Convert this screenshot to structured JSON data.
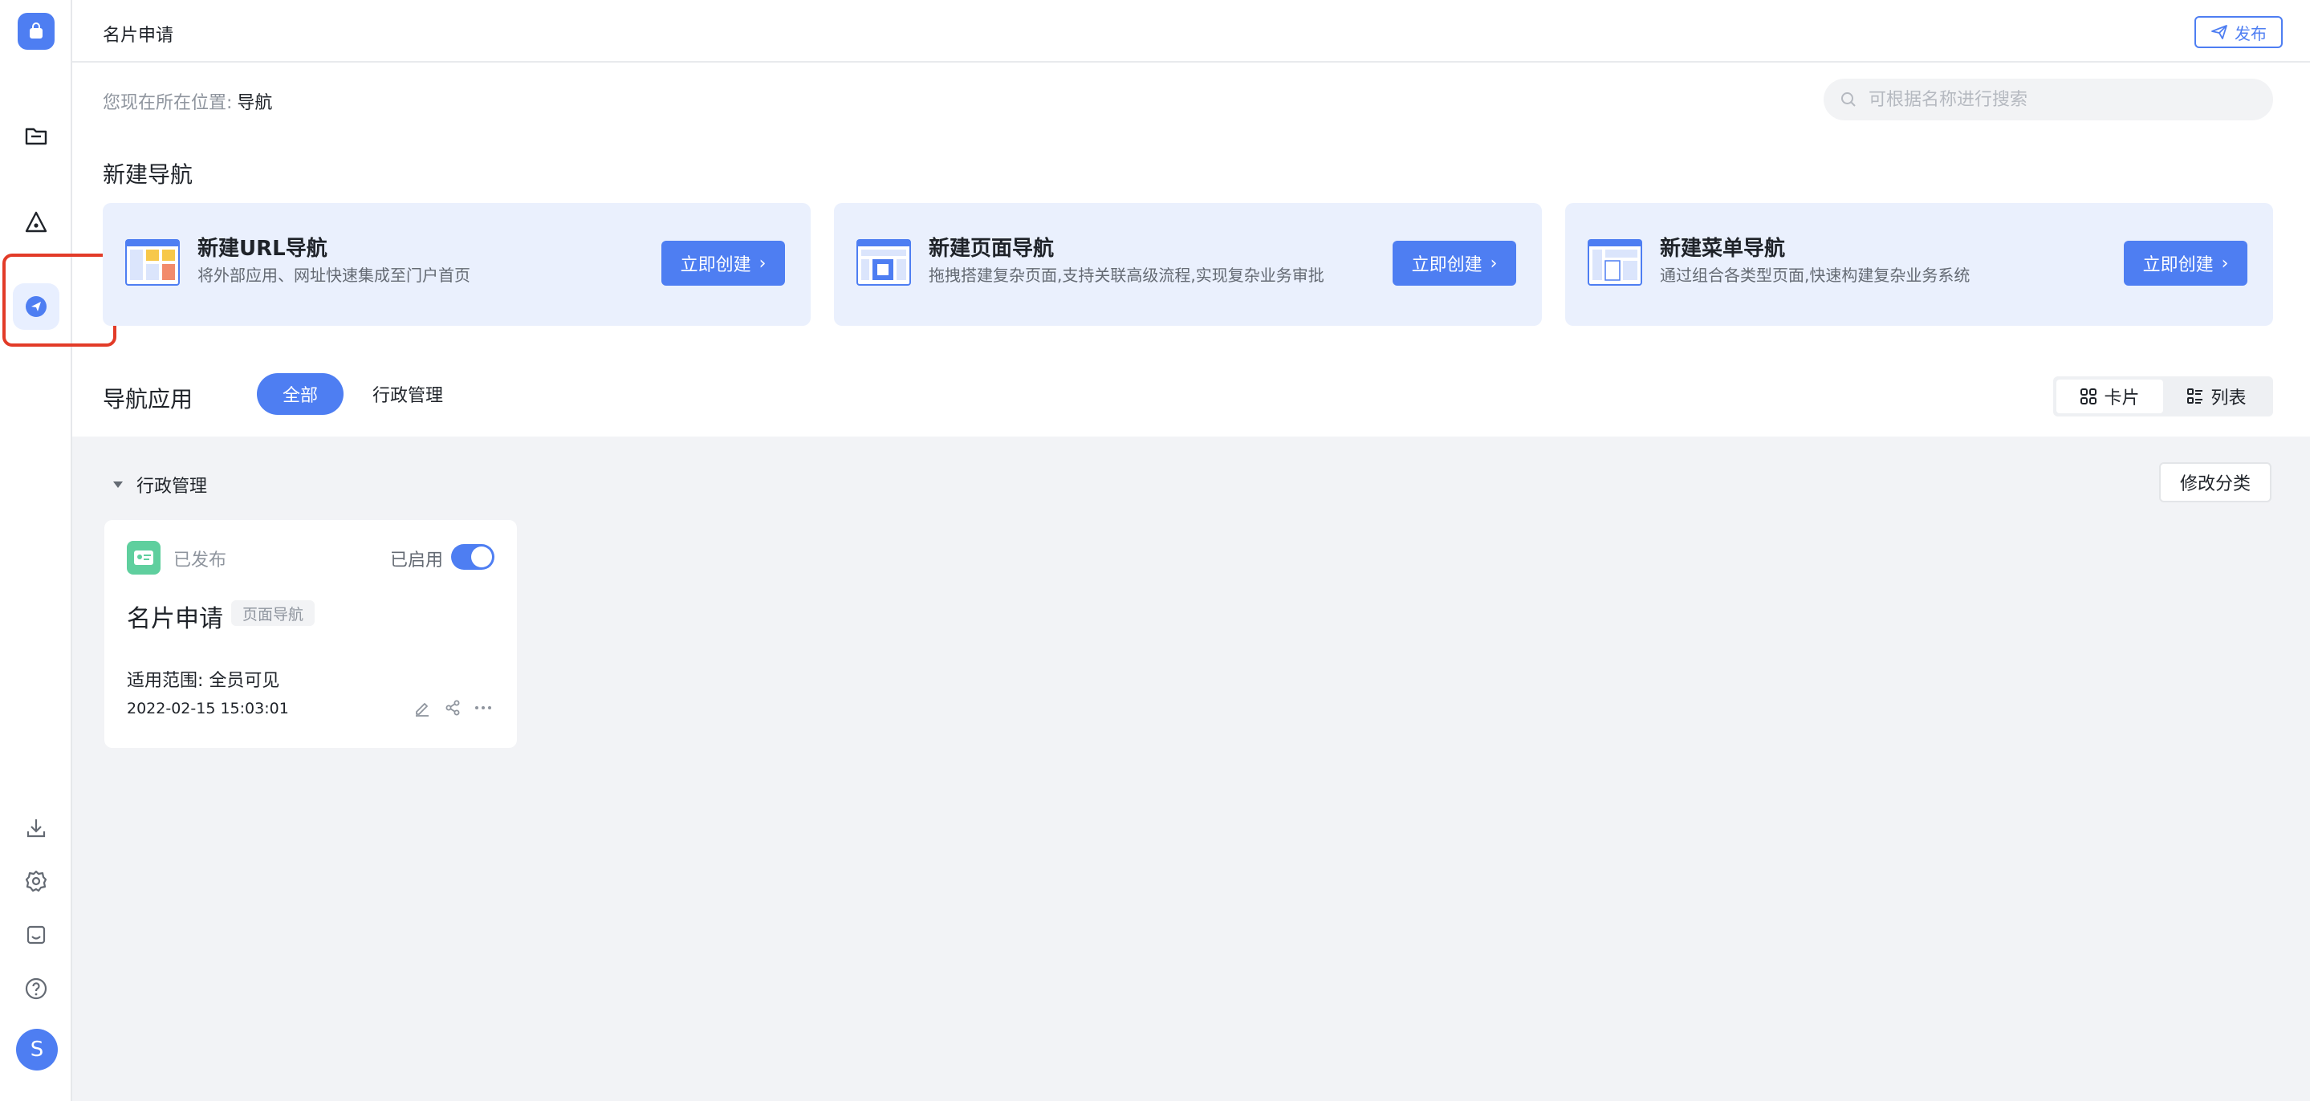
{
  "topbar": {
    "title": "名片申请",
    "publish_label": "发布"
  },
  "breadcrumb": {
    "prefix": "您现在所在位置:",
    "current": "导航"
  },
  "search": {
    "placeholder": "可根据名称进行搜索"
  },
  "new_nav": {
    "title": "新建导航",
    "cards": [
      {
        "name": "新建URL导航",
        "desc": "将外部应用、网址快速集成至门户首页",
        "button": "立即创建"
      },
      {
        "name": "新建页面导航",
        "desc": "拖拽搭建复杂页面,支持关联高级流程,实现复杂业务审批",
        "button": "立即创建"
      },
      {
        "name": "新建菜单导航",
        "desc": "通过组合各类型页面,快速构建复杂业务系统",
        "button": "立即创建"
      }
    ]
  },
  "apps": {
    "title": "导航应用",
    "tabs": [
      "全部",
      "行政管理"
    ],
    "views": [
      "卡片",
      "列表"
    ],
    "category": "行政管理",
    "edit_category_label": "修改分类",
    "cards": [
      {
        "status": "已发布",
        "enabled_label": "已启用",
        "enabled": true,
        "name": "名片申请",
        "type": "页面导航",
        "scope": "适用范围: 全员可见",
        "date": "2022-02-15 15:03:01"
      }
    ]
  },
  "user": {
    "avatar_letter": "S"
  },
  "colors": {
    "accent": "#4e7ef2",
    "card_bg": "#eaf0fd",
    "highlight": "#e23b28",
    "app_icon": "#5fcf9e"
  }
}
